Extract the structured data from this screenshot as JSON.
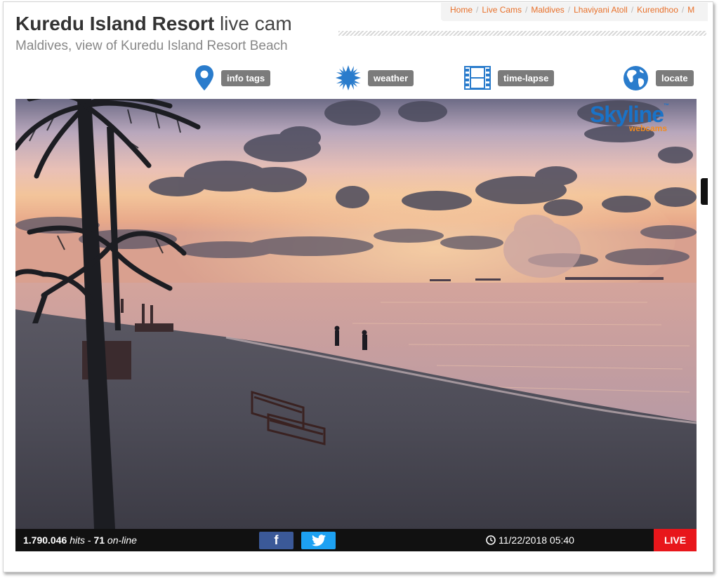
{
  "header": {
    "title_name": "Kuredu Island Resort",
    "title_suffix": "live cam",
    "subtitle": "Maldives, view of Kuredu Island Resort Beach"
  },
  "breadcrumb": {
    "items": [
      "Home",
      "Live Cams",
      "Maldives",
      "Lhaviyani Atoll",
      "Kurendhoo",
      "M"
    ],
    "separator": "/"
  },
  "toolbar": {
    "info_tags": "info tags",
    "weather": "weather",
    "time_lapse": "time-lapse",
    "locate": "locate"
  },
  "logo": {
    "main": "Skyline",
    "sub": "webcams",
    "tm": "™"
  },
  "stats": {
    "hits_value": "1.790.046",
    "hits_label": "hits",
    "dash": "-",
    "online_value": "71",
    "online_label": "on-line"
  },
  "share": {
    "facebook": "f",
    "twitter": "twitter-icon"
  },
  "timestamp": "11/22/2018 05:40",
  "live_badge": "LIVE",
  "colors": {
    "accent_orange": "#e8702a",
    "icon_blue": "#2a7ccc",
    "pill_gray": "#7b7b7b",
    "live_red": "#e8161b",
    "facebook": "#3b5998",
    "twitter": "#1da1f2"
  }
}
